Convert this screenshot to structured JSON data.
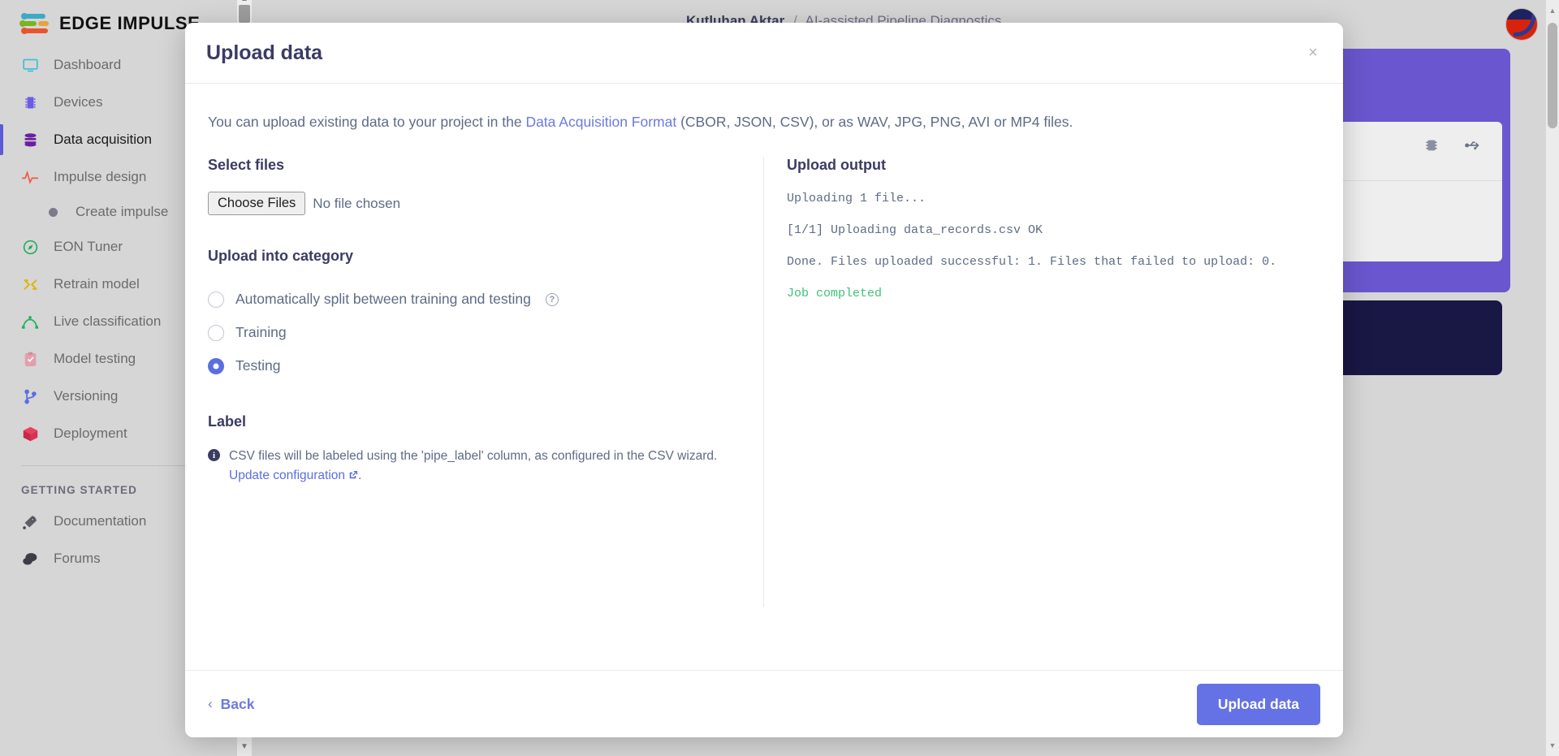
{
  "app": {
    "logo_text": "EDGE IMPULSE",
    "breadcrumb": {
      "owner": "Kutluhan Aktar",
      "separator": "/",
      "project": "AI-assisted Pipeline Diagnostics"
    }
  },
  "sidebar": {
    "items": [
      {
        "label": "Dashboard",
        "icon": "monitor-icon",
        "active": false
      },
      {
        "label": "Devices",
        "icon": "chip-icon",
        "active": false
      },
      {
        "label": "Data acquisition",
        "icon": "database-icon",
        "active": true
      },
      {
        "label": "Impulse design",
        "icon": "waveform-icon",
        "active": false
      },
      {
        "label": "EON Tuner",
        "icon": "compass-icon",
        "active": false
      },
      {
        "label": "Retrain model",
        "icon": "shuffle-icon",
        "active": false
      },
      {
        "label": "Live classification",
        "icon": "curve-icon",
        "active": false
      },
      {
        "label": "Model testing",
        "icon": "clipboard-check-icon",
        "active": false
      },
      {
        "label": "Versioning",
        "icon": "branch-icon",
        "active": false
      },
      {
        "label": "Deployment",
        "icon": "box-icon",
        "active": false
      }
    ],
    "sub_item": {
      "label": "Create impulse",
      "parent": "Impulse design"
    },
    "section_title": "GETTING STARTED",
    "footer_items": [
      {
        "label": "Documentation",
        "icon": "rocket-icon"
      },
      {
        "label": "Forums",
        "icon": "chat-icon"
      }
    ]
  },
  "modal": {
    "title": "Upload data",
    "close_label": "×",
    "description": {
      "before_link": "You can upload existing data to your project in the ",
      "link_text": "Data Acquisition Format",
      "after_link": " (CBOR, JSON, CSV), or as WAV, JPG, PNG, AVI or MP4 files."
    },
    "select_files": {
      "heading": "Select files",
      "button_label": "Choose Files",
      "status_text": "No file chosen"
    },
    "upload_category": {
      "heading": "Upload into category",
      "options": [
        {
          "label": "Automatically split between training and testing",
          "checked": false,
          "has_help": true
        },
        {
          "label": "Training",
          "checked": false,
          "has_help": false
        },
        {
          "label": "Testing",
          "checked": true,
          "has_help": false
        }
      ]
    },
    "label_section": {
      "heading": "Label",
      "note": "CSV files will be labeled using the 'pipe_label' column, as configured in the CSV wizard.",
      "link_text": "Update configuration",
      "trailing": "."
    },
    "upload_output": {
      "heading": "Upload output",
      "lines": [
        "Uploading 1 file...",
        "[1/1] Uploading data_records.csv OK",
        "Done. Files uploaded successful: 1. Files that failed to upload: 0."
      ],
      "status": "Job completed"
    },
    "footer": {
      "back_label": "Back",
      "back_chevron": "‹",
      "upload_label": "Upload data"
    }
  },
  "colors": {
    "accent": "#6472e6",
    "link": "#6b7ae0",
    "success": "#3ec27a",
    "heading": "#3b3b63",
    "hero": "#6a57cf",
    "dark_card": "#191744"
  }
}
